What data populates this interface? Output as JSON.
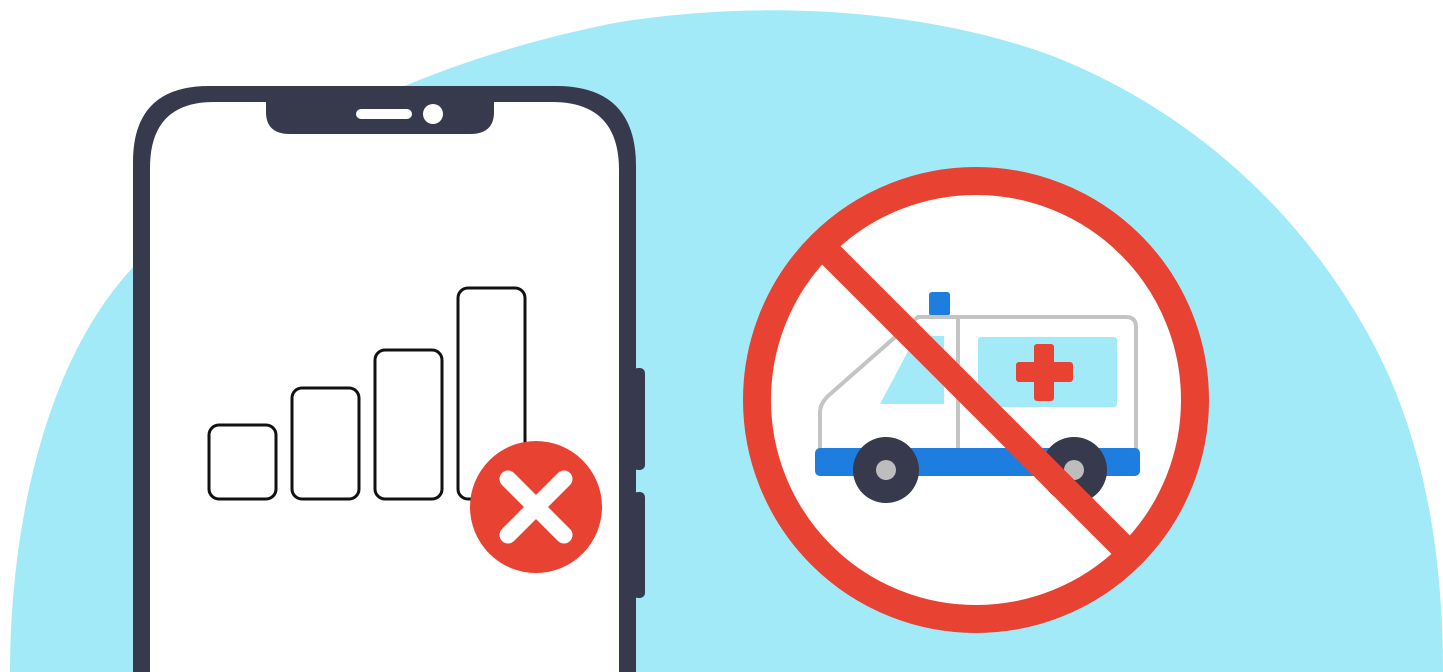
{
  "illustration": {
    "background_color": "#ffffff",
    "blob_color": "#a2eaf8",
    "phone": {
      "frame_color": "#363a4c",
      "screen_color": "#ffffff",
      "signal_bars": 4,
      "signal_bar_outline_color": "#111111",
      "no_signal_badge_color": "#e84233",
      "no_signal_badge_icon": "close-icon"
    },
    "no_ambulance_sign": {
      "prohibition_color": "#e84233",
      "ambulance_body_color": "#ffffff",
      "ambulance_outline_color": "#c4c4c4",
      "ambulance_window_color": "#a2eaf8",
      "ambulance_stripe_color": "#1d7ee0",
      "siren_color": "#1d7ee0",
      "medical_cross_color": "#e84233",
      "wheel_color": "#363a4c",
      "hub_color": "#bdbdbd"
    }
  }
}
